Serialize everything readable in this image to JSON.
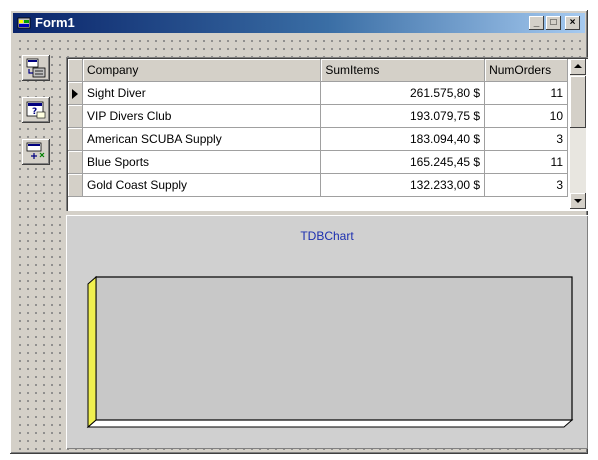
{
  "window": {
    "title": "Form1",
    "minimize_glyph": "_",
    "maximize_glyph": "□",
    "close_glyph": "×"
  },
  "palette": {
    "icons": [
      "query-component-icon",
      "report-component-icon",
      "chart-component-icon"
    ]
  },
  "grid": {
    "columns": [
      "Company",
      "SumItems",
      "NumOrders"
    ],
    "current_row": 0,
    "rows": [
      {
        "company": "Sight Diver",
        "sum_items": "261.575,80 $",
        "num_orders": "11"
      },
      {
        "company": "VIP Divers Club",
        "sum_items": "193.079,75 $",
        "num_orders": "10"
      },
      {
        "company": "American SCUBA Supply",
        "sum_items": "183.094,40 $",
        "num_orders": "3"
      },
      {
        "company": "Blue Sports",
        "sum_items": "165.245,45 $",
        "num_orders": "11"
      },
      {
        "company": "Gold Coast Supply",
        "sum_items": "132.233,00 $",
        "num_orders": "3"
      }
    ]
  },
  "chart": {
    "title": "TDBChart",
    "wall_color": "#c8c8c8",
    "floor_color": "#ffffff",
    "left_wall_color": "#f0f050"
  }
}
